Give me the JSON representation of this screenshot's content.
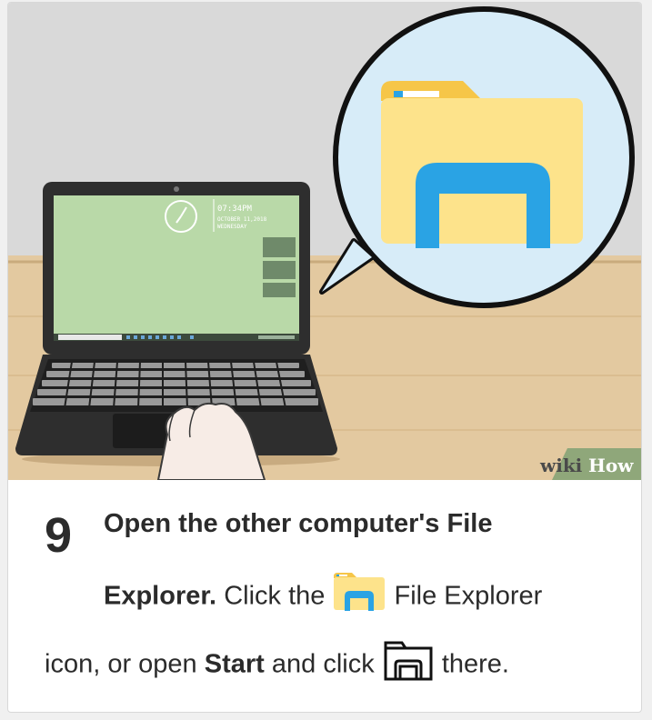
{
  "illustration": {
    "clock_time": "07:34PM",
    "clock_date": "OCTOBER 11,2018",
    "clock_day": "WEDNESDAY",
    "watermark_wiki": "wiki",
    "watermark_how": "How"
  },
  "step": {
    "number": "9",
    "title_line1": "Open the other computer's File",
    "title_line2_bold": "Explorer.",
    "text_click_the": "Click the",
    "text_file_explorer": "File Explorer",
    "text_icon_or_open": "icon, or open",
    "text_start": "Start",
    "text_and_click": "and click",
    "text_there": "there."
  },
  "icons": [
    "file-explorer-icon",
    "file-explorer-outline-icon",
    "clock-icon"
  ],
  "colors": {
    "wall": "#d9d9d9",
    "desk": "#e3c9a0",
    "screen": "#b9d9a8",
    "bubble": "#d7ecf8",
    "folder": "#fde38b",
    "folder_tab": "#f6c648",
    "explorer_blue": "#2aa3e4",
    "watermark_bg": "#8fa77a"
  }
}
